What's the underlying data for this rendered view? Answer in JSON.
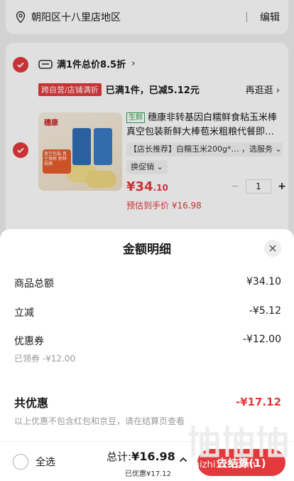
{
  "address": {
    "text": "朝阳区十八里店地区",
    "edit_label": "编辑"
  },
  "shop": {
    "promo_text": "满1件总价8.5折",
    "promo_arrow": "›",
    "tag": "跨自营/店铺满折",
    "tag_status": "已满1件，已减5.12元",
    "more_label": "再逛逛 ›",
    "product": {
      "badge": "生鲜",
      "title": "穗康非转基因白糯鲜食粘玉米棒真空包装新鲜大棒苞米粗粮代餐即…",
      "option": "【店长推荐】白糯玉米200g*… ，选服务 ⌄",
      "promo_option": "换促销 ⌄",
      "price_main": "¥34",
      "price_decimal": ".10",
      "qty": "1",
      "minus": "−",
      "plus": "+",
      "estimate": "预估到手价 ¥16.98",
      "image_brand": "穗康",
      "image_label": "真空包装 真空保鲜 新鲜现摘"
    }
  },
  "sheet": {
    "title": "金额明细",
    "rows": [
      {
        "label": "商品总额",
        "value": "¥34.10"
      },
      {
        "label": "立减",
        "value": "-¥5.12"
      },
      {
        "label": "优惠券",
        "value": "-¥12.00"
      }
    ],
    "coupon_hint": "已领券 -¥12.00",
    "total_label": "共优惠",
    "total_value": "-¥17.12",
    "note": "以上优惠不包含红包和京豆，请在结算页查看"
  },
  "bottom": {
    "select_all": "全选",
    "sum_label": "总计:",
    "sum_value": "¥16.98",
    "saved": "已优惠¥17.12",
    "checkout": "去结算(1)"
  },
  "watermark": {
    "text": "zhizhi123.com"
  },
  "colors": {
    "accent": "#e4393c",
    "fresh": "#2fa84f"
  }
}
